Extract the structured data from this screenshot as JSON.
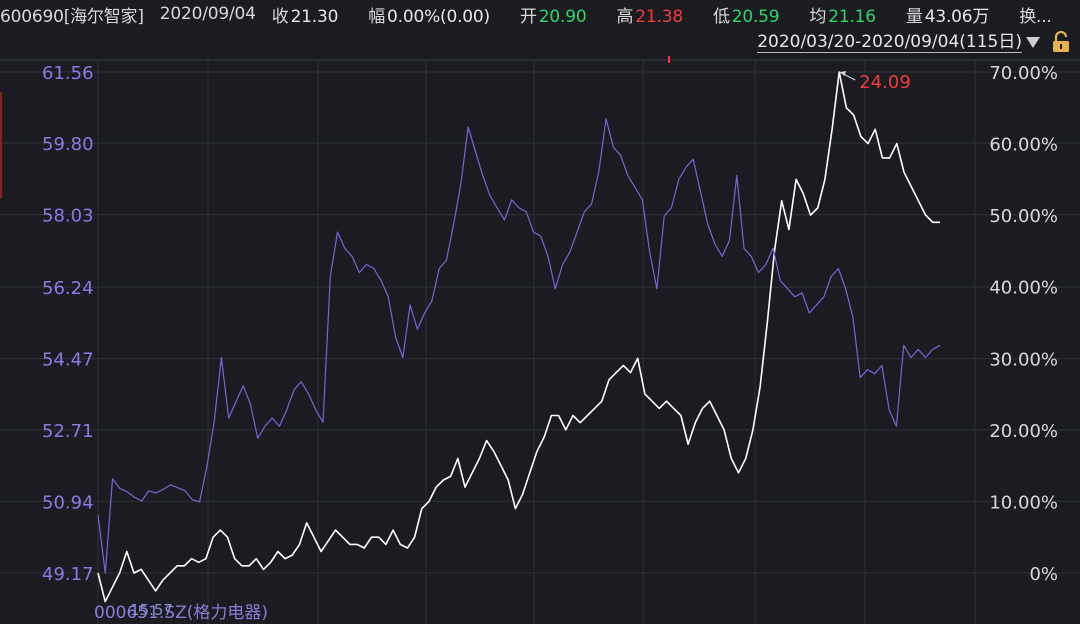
{
  "header": {
    "stock": "600690[海尔智家]",
    "date": "2020/09/04",
    "close_label": "收",
    "close_value": "21.30",
    "change_label": "幅",
    "change_value": "0.00%(0.00)",
    "open_label": "开",
    "open_value": "20.90",
    "high_label": "高",
    "high_value": "21.38",
    "low_label": "低",
    "low_value": "20.59",
    "avg_label": "均",
    "avg_value": "21.16",
    "volume_label": "量",
    "volume_value": "43.06万",
    "turnover_label": "换..."
  },
  "range": {
    "text": "2020/03/20-2020/09/04(115日)"
  },
  "compare_label": "000651.SZ(格力电器)",
  "overlap_value": "15.57",
  "chart_data": {
    "type": "line",
    "left_axis": {
      "ticks": [
        "61.56",
        "59.80",
        "58.03",
        "56.24",
        "54.47",
        "52.71",
        "50.94",
        "49.17"
      ],
      "values": [
        61.56,
        59.8,
        58.03,
        56.24,
        54.47,
        52.71,
        50.94,
        49.17
      ],
      "color": "#8a7ae6"
    },
    "right_axis": {
      "ticks": [
        "70.00%",
        "60.00%",
        "50.00%",
        "40.00%",
        "30.00%",
        "20.00%",
        "10.00%",
        "0%"
      ],
      "values": [
        70,
        60,
        50,
        40,
        30,
        20,
        10,
        0
      ]
    },
    "annotation": {
      "label": "24.09",
      "color": "#f23a3a"
    },
    "series": [
      {
        "color": "#ffffff",
        "unit": "percent change",
        "values": [
          0,
          -4,
          -2,
          0,
          3,
          0,
          0.5,
          -1,
          -2.5,
          -1,
          0,
          1,
          1,
          2,
          1.5,
          2,
          5,
          6,
          5,
          2,
          1,
          1,
          2,
          0.5,
          1.5,
          3,
          2,
          2.5,
          4,
          7,
          5,
          3,
          4.5,
          6,
          5,
          4,
          4,
          3.5,
          5,
          5,
          4,
          6,
          4,
          3.5,
          5,
          9,
          10,
          12,
          13,
          13.5,
          16,
          12,
          14,
          16,
          18.5,
          17,
          15,
          13,
          9,
          11,
          14,
          17,
          19,
          22,
          22,
          20,
          22,
          21,
          22,
          23,
          24,
          27,
          28,
          29,
          28,
          30,
          25,
          24,
          23,
          24,
          23,
          22,
          18,
          21,
          23,
          24,
          22,
          20,
          16,
          14,
          16,
          20,
          26,
          35,
          45,
          52,
          48,
          55,
          53,
          50,
          51,
          55,
          62,
          70,
          65,
          64,
          61,
          60,
          62,
          58,
          58,
          60,
          56,
          54,
          52,
          50,
          49,
          49
        ]
      },
      {
        "color": "#7a63d8",
        "unit": "price",
        "values": [
          50.6,
          49.17,
          51.5,
          51.26,
          51.18,
          51.05,
          50.95,
          51.2,
          51.15,
          51.24,
          51.35,
          51.28,
          51.2,
          50.98,
          50.93,
          51.8,
          52.9,
          54.5,
          53.0,
          53.4,
          53.8,
          53.35,
          52.5,
          52.8,
          53.0,
          52.8,
          53.2,
          53.7,
          53.9,
          53.6,
          53.2,
          52.9,
          56.5,
          57.6,
          57.2,
          57.0,
          56.6,
          56.8,
          56.7,
          56.4,
          56.0,
          55.0,
          54.5,
          55.8,
          55.2,
          55.6,
          55.9,
          56.7,
          56.9,
          57.8,
          58.8,
          60.2,
          59.6,
          59.0,
          58.5,
          58.2,
          57.9,
          58.4,
          58.2,
          58.1,
          57.6,
          57.5,
          57.0,
          56.2,
          56.8,
          57.1,
          57.6,
          58.1,
          58.3,
          59.1,
          60.4,
          59.7,
          59.5,
          59.0,
          58.7,
          58.4,
          57.1,
          56.2,
          58.0,
          58.2,
          58.9,
          59.2,
          59.4,
          58.6,
          57.8,
          57.3,
          57.0,
          57.4,
          59.0,
          57.2,
          57.0,
          56.6,
          56.8,
          57.2,
          56.4,
          56.2,
          56.0,
          56.1,
          55.6,
          55.8,
          56.0,
          56.5,
          56.7,
          56.2,
          55.5,
          54.0,
          54.2,
          54.1,
          54.3,
          53.2,
          52.8,
          54.8,
          54.5,
          54.7,
          54.5,
          54.7,
          54.8
        ]
      }
    ]
  }
}
